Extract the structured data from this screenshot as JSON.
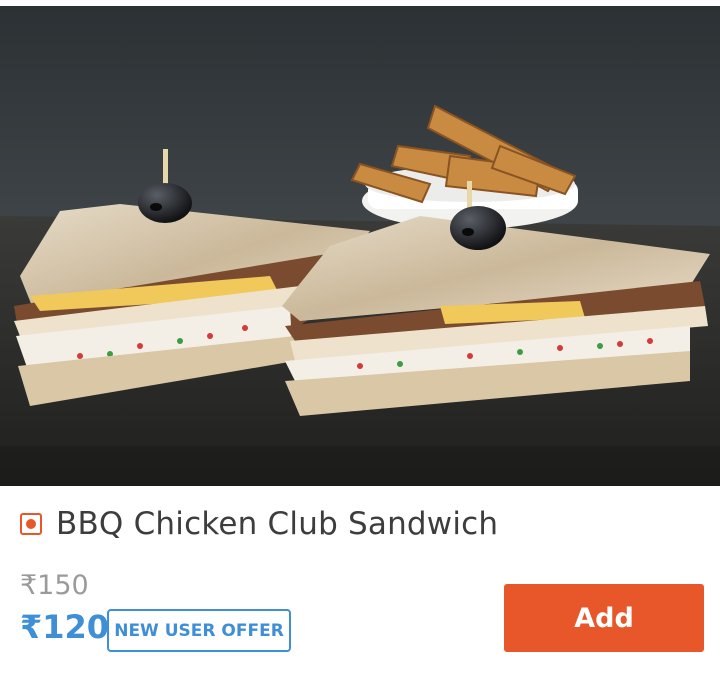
{
  "item": {
    "name": "BBQ Chicken Club Sandwich",
    "original_price": "₹150",
    "offer_price": "₹120",
    "offer_label": "NEW USER OFFER",
    "add_label": "Add"
  },
  "icons": {
    "food_type": "non-veg-indicator-icon"
  },
  "colors": {
    "accent": "#e8572a",
    "price_blue": "#3f8fd6",
    "title": "#3d3d3d",
    "strike": "#9a9a9a"
  }
}
